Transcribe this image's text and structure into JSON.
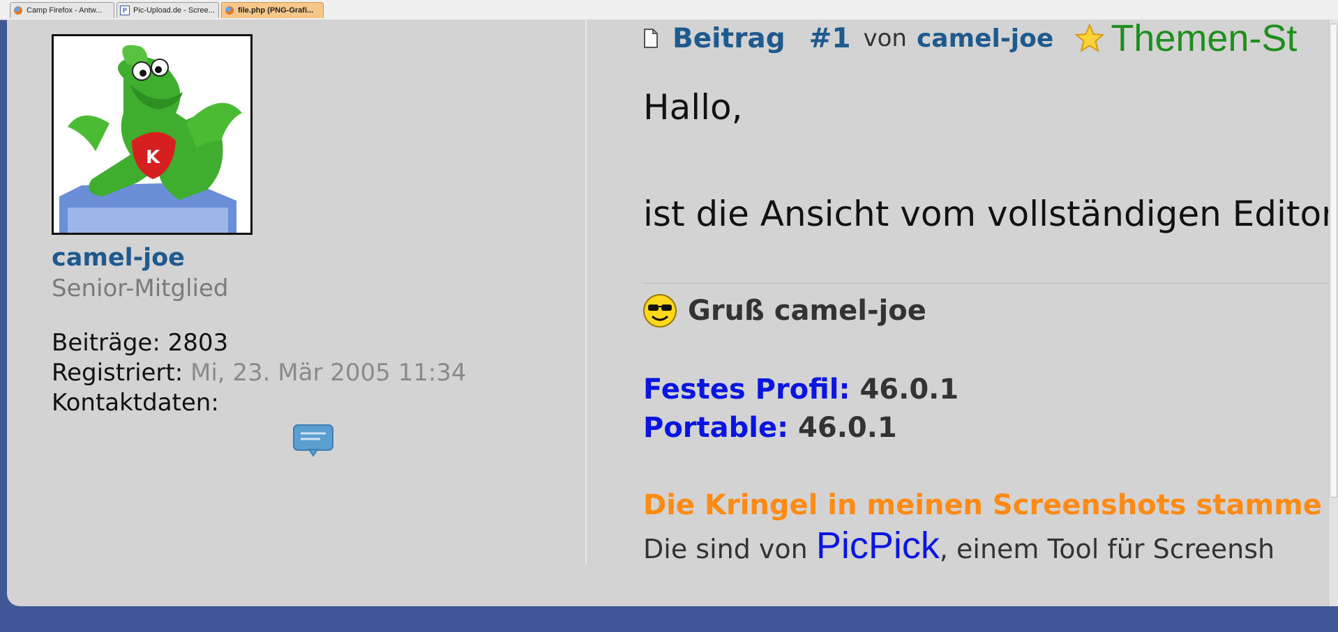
{
  "browser": {
    "tabs": [
      {
        "label": "Camp Firefox - Antw...",
        "icon": "firefox-icon",
        "active": false
      },
      {
        "label": "Pic-Upload.de - Scree...",
        "icon": "picupload-icon",
        "active": false
      },
      {
        "label": "file.php (PNG-Grafi...",
        "icon": "firefox-icon",
        "active": true
      }
    ]
  },
  "profile": {
    "username": "camel-joe",
    "rank": "Senior-Mitglied",
    "posts_label": "Beiträge:",
    "posts_value": "2803",
    "registered_label": "Registriert:",
    "registered_value": "Mi, 23. Mär 2005 11:34",
    "contact_label": "Kontaktdaten:"
  },
  "post": {
    "header_beitrag": "Beitrag",
    "header_number": "#1",
    "header_von": "von",
    "header_user": "camel-joe",
    "header_badge": "Themen-St",
    "greeting": "Hallo,",
    "body_line": "ist die Ansicht vom vollständigen Editor"
  },
  "signature": {
    "greeting": "Gruß camel-joe",
    "festes_label": "Festes Profil:",
    "festes_value": "46.0.1",
    "portable_label": "Portable:",
    "portable_value": "46.0.1",
    "orange_line": "Die Kringel in meinen Screenshots stamme",
    "last_prefix": "Die sind von ",
    "last_link": "PicPick",
    "last_suffix": ", einem Tool für Screensh"
  },
  "colors": {
    "page_bg": "#3f5898",
    "panel_bg": "#d3d3d3",
    "link_blue": "#1f5a8f",
    "sig_blue": "#0a16e0",
    "orange": "#ff8a14",
    "badge_green": "#1e8f1e"
  }
}
